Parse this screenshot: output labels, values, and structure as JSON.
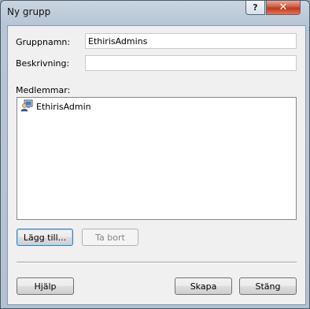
{
  "window": {
    "title": "Ny grupp"
  },
  "titlebar": {
    "help_glyph": "?",
    "close_glyph": "✕"
  },
  "form": {
    "group_name_label": "Gruppnamn:",
    "group_name_value": "EthirisAdmins",
    "description_label": "Beskrivning:",
    "description_value": "",
    "members_label": "Medlemmar:"
  },
  "members": [
    {
      "name": "EthirisAdmin",
      "icon": "user-icon"
    }
  ],
  "buttons": {
    "add": "Lägg till...",
    "remove": "Ta bort",
    "help": "Hjälp",
    "create": "Skapa",
    "close": "Stäng"
  }
}
